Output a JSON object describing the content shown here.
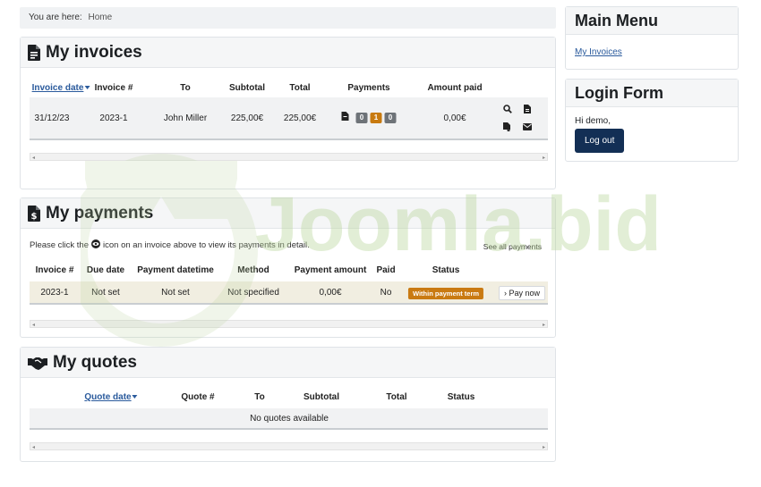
{
  "breadcrumb": {
    "prefix": "You are here:",
    "home": "Home"
  },
  "invoices": {
    "title": "My invoices",
    "headers": [
      "Invoice date",
      "Invoice #",
      "To",
      "Subtotal",
      "Total",
      "Payments",
      "Amount paid"
    ],
    "rows": [
      {
        "date": "31/12/23",
        "number": "2023-1",
        "to": "John Miller",
        "subtotal": "225,00€",
        "total": "225,00€",
        "payment_badges": [
          "0",
          "1",
          "0"
        ],
        "amount_paid": "0,00€"
      }
    ]
  },
  "payments": {
    "title": "My payments",
    "hint_before": "Please click the",
    "hint_after": "icon on an invoice above to view its payments in detail.",
    "see_all": "See all payments",
    "headers": [
      "Invoice #",
      "Due date",
      "Payment datetime",
      "Method",
      "Payment amount",
      "Paid",
      "Status"
    ],
    "rows": [
      {
        "invoice": "2023-1",
        "due": "Not set",
        "datetime": "Not set",
        "method": "Not specified",
        "amount": "0,00€",
        "paid": "No",
        "status": "Within payment term",
        "action": "Pay now"
      }
    ]
  },
  "quotes": {
    "title": "My quotes",
    "headers": [
      "Quote date",
      "Quote #",
      "To",
      "Subtotal",
      "Total",
      "Status"
    ],
    "empty": "No quotes available"
  },
  "main_menu": {
    "title": "Main Menu",
    "items": [
      "My Invoices"
    ]
  },
  "login_form": {
    "title": "Login Form",
    "greeting": "Hi demo,",
    "logout": "Log out"
  },
  "watermark": {
    "text": "Joomla.bid"
  },
  "colors": {
    "accent": "#c87a0f",
    "link": "#2a5a9c",
    "button": "#132f55"
  }
}
